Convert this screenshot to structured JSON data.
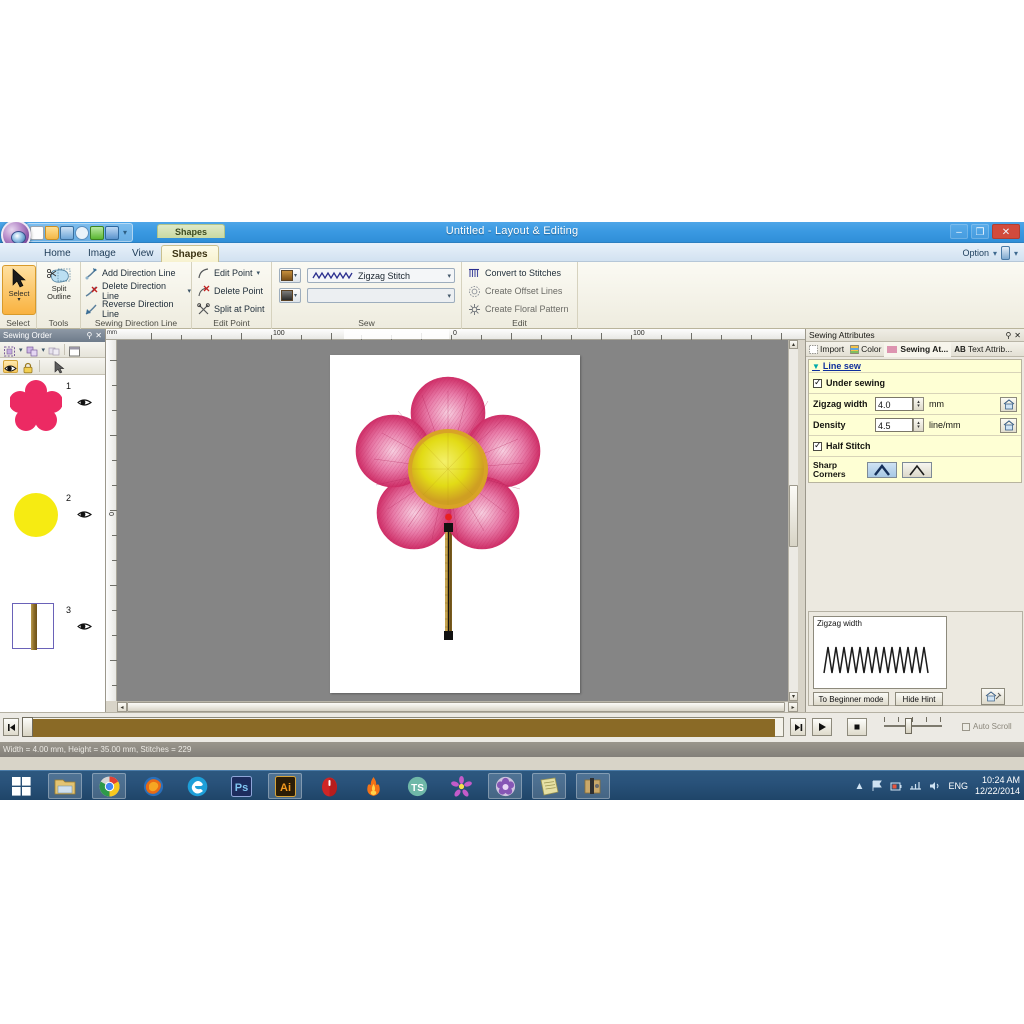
{
  "window": {
    "title": "Untitled - Layout & Editing",
    "minimize": "–",
    "maximize": "❐",
    "close": "✕",
    "option_label": "Option",
    "context_tab": "Shapes"
  },
  "quick_access": {
    "items": [
      {
        "name": "new-file-icon",
        "tip": "New"
      },
      {
        "name": "open-file-icon",
        "tip": "Open"
      },
      {
        "name": "save-icon",
        "tip": "Save"
      },
      {
        "name": "zoom-icon",
        "tip": "Zoom"
      },
      {
        "name": "undo-icon",
        "tip": "Undo"
      },
      {
        "name": "redo-icon",
        "tip": "Redo"
      }
    ],
    "caret": "▾"
  },
  "ribbon": {
    "tabs": [
      {
        "label": "Home",
        "active": false
      },
      {
        "label": "Image",
        "active": false
      },
      {
        "label": "View",
        "active": false
      },
      {
        "label": "Shapes",
        "active": true
      }
    ],
    "groups": [
      {
        "title": "Select",
        "buttons": [
          {
            "label": "Select",
            "caret": "▾"
          }
        ]
      },
      {
        "title": "Tools",
        "buttons": [
          {
            "label_line1": "Split",
            "label_line2": "Outline"
          }
        ]
      },
      {
        "title": "Sewing Direction Line",
        "items": [
          {
            "label": "Add Direction Line",
            "caret": ""
          },
          {
            "label": "Delete Direction Line",
            "caret": "▾"
          },
          {
            "label": "Reverse Direction Line",
            "caret": ""
          }
        ]
      },
      {
        "title": "Edit Point",
        "items": [
          {
            "label": "Edit Point",
            "caret": "▾"
          },
          {
            "label": "Delete Point",
            "caret": ""
          },
          {
            "label": "Split at Point",
            "caret": ""
          }
        ]
      },
      {
        "title": "Sew",
        "line_combo_value": "Zigzag Stitch",
        "region_combo_value": "",
        "caret": "▾"
      },
      {
        "title": "Edit",
        "items": [
          {
            "label": "Convert to Stitches"
          },
          {
            "label": "Create Offset Lines"
          },
          {
            "label": "Create Floral Pattern"
          }
        ]
      }
    ]
  },
  "sewing_order": {
    "panel_title": "Sewing Order",
    "pin": "⚲",
    "close": "✕",
    "objects": [
      {
        "index": "1",
        "shape": "flower",
        "color": "#ec2a63"
      },
      {
        "index": "2",
        "shape": "circle",
        "color": "#f6eb12"
      },
      {
        "index": "3",
        "shape": "stem",
        "color": "#8a6a26"
      }
    ]
  },
  "rulers": {
    "unit": "mm",
    "h_labels": [
      "100",
      "0",
      "100"
    ],
    "v_labels": [
      "0"
    ]
  },
  "sewing_attributes": {
    "panel_title": "Sewing Attributes",
    "pin": "⚲",
    "close": "✕",
    "tabs": [
      {
        "label": "Import",
        "icon": "import-icon",
        "active": false
      },
      {
        "label": "Color",
        "icon": "color-icon",
        "active": false
      },
      {
        "label": "Sewing At...",
        "icon": "sewing-attributes-icon",
        "active": true
      },
      {
        "label": "Text Attrib...",
        "icon": "text-attributes-icon",
        "active": false
      }
    ],
    "section_title": "Line sew",
    "expander": "▼",
    "under_sewing": {
      "label": "Under sewing",
      "checked": true
    },
    "zigzag_width": {
      "label": "Zigzag width",
      "value": "4.0",
      "unit": "mm"
    },
    "density": {
      "label": "Density",
      "value": "4.5",
      "unit": "line/mm"
    },
    "half_stitch": {
      "label": "Half Stitch",
      "checked": true
    },
    "sharp_corners": {
      "label_line1": "Sharp",
      "label_line2": "Corners",
      "options": [
        "sharp-corner-on",
        "sharp-corner-off"
      ],
      "selected": 0
    },
    "reset_icon": "home-reset-icon"
  },
  "hint": {
    "title": "Zigzag width",
    "to_beginner": "To Beginner mode",
    "hide_hint": "Hide Hint",
    "settings_icon": "home-settings-icon"
  },
  "playback": {
    "rewind_icon": "skip-start-icon",
    "forward_icon": "skip-end-icon",
    "play_icon": "play-icon",
    "stop_icon": "stop-icon",
    "auto_scroll": {
      "label": "Auto Scroll",
      "checked": false
    }
  },
  "status_bar": {
    "text": "Width = 4.00 mm,  Height = 35.00 mm,  Stitches = 229"
  },
  "design": {
    "petal_color": "#e0558c",
    "petal_edge_color": "#cf2f68",
    "center_color": "#e8e020",
    "center_ring_color": "#d8a326",
    "stem_color": "#9a7a2e",
    "node_color": "#111111",
    "start_point_color": "#e81f1f"
  },
  "taskbar": {
    "start_icon": "windows-start-icon",
    "items": [
      {
        "name": "file-explorer-icon",
        "label": "File Explorer",
        "active": true
      },
      {
        "name": "chrome-icon",
        "label": "Google Chrome",
        "active": true
      },
      {
        "name": "firefox-icon",
        "label": "Mozilla Firefox",
        "active": false
      },
      {
        "name": "edge-icon",
        "label": "Internet Explorer",
        "active": false
      },
      {
        "name": "photoshop-icon",
        "label": "Ps",
        "active": false
      },
      {
        "name": "illustrator-icon",
        "label": "Ai",
        "active": true
      },
      {
        "name": "mouse-recorder-icon",
        "label": "Mouse",
        "active": false
      },
      {
        "name": "flame-icon",
        "label": "Flame",
        "active": false
      },
      {
        "name": "ts-icon",
        "label": "TS",
        "active": false
      },
      {
        "name": "pink-flower-icon",
        "label": "Flower",
        "active": false
      },
      {
        "name": "purple-flower-icon",
        "label": "Layout & Editing",
        "active": true
      },
      {
        "name": "notes-icon",
        "label": "Notes",
        "active": true
      },
      {
        "name": "tool-icon",
        "label": "Tool",
        "active": true
      }
    ],
    "tray": {
      "chevron": "▲",
      "icons": [
        "flag-icon",
        "battery-icon",
        "network-icon",
        "volume-icon"
      ],
      "language": "ENG",
      "time": "10:24 AM",
      "date": "12/22/2014"
    }
  }
}
